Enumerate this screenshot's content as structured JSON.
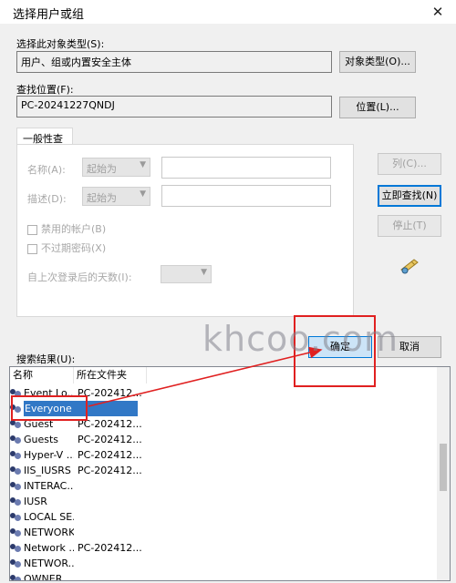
{
  "window": {
    "title": "选择用户或组",
    "close_glyph": "✕"
  },
  "object_type": {
    "label": "选择此对象类型(S):",
    "value": "用户、组或内置安全主体",
    "button": "对象类型(O)..."
  },
  "location": {
    "label": "查找位置(F):",
    "value": "PC-20241227QNDJ",
    "button": "位置(L)..."
  },
  "query": {
    "tab": "一般性查询",
    "name_label": "名称(A):",
    "name_mode": "起始为",
    "desc_label": "描述(D):",
    "desc_mode": "起始为",
    "disabled_accounts": "禁用的帐户(B)",
    "non_expiring": "不过期密码(X)",
    "days_label": "自上次登录后的天数(I):"
  },
  "buttons": {
    "columns": "列(C)...",
    "find_now": "立即查找(N)",
    "stop": "停止(T)",
    "ok": "确定",
    "cancel": "取消"
  },
  "results": {
    "label": "搜索结果(U):",
    "columns": [
      "名称",
      "所在文件夹"
    ],
    "rows": [
      {
        "name": "Event Lo...",
        "folder": "PC-202412..."
      },
      {
        "name": "Everyone",
        "folder": ""
      },
      {
        "name": "Guest",
        "folder": "PC-202412..."
      },
      {
        "name": "Guests",
        "folder": "PC-202412..."
      },
      {
        "name": "Hyper-V ...",
        "folder": "PC-202412..."
      },
      {
        "name": "IIS_IUSRS",
        "folder": "PC-202412..."
      },
      {
        "name": "INTERAC...",
        "folder": ""
      },
      {
        "name": "IUSR",
        "folder": ""
      },
      {
        "name": "LOCAL SE...",
        "folder": ""
      },
      {
        "name": "NETWORK",
        "folder": ""
      },
      {
        "name": "Network ...",
        "folder": "PC-202412..."
      },
      {
        "name": "NETWOR...",
        "folder": ""
      },
      {
        "name": "OWNER",
        "folder": ""
      }
    ],
    "selected_row": 1
  },
  "watermark": "khcoo.com",
  "colors": {
    "highlight_box": "#e02020",
    "selection": "#3178c6",
    "arrow": "#e02020"
  }
}
